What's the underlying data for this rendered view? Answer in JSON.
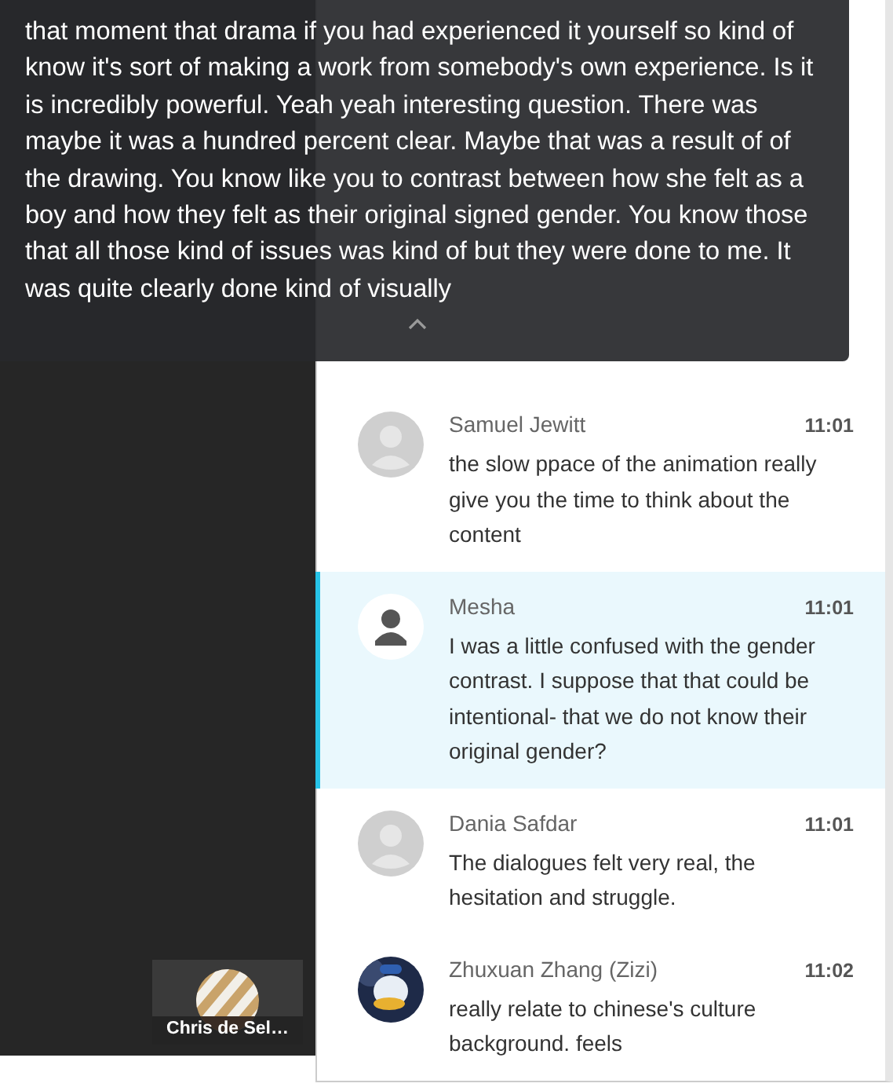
{
  "caption": {
    "text": "that moment that drama if you had experienced it yourself so kind of know it's sort of making a work from somebody's own experience. Is it is incredibly powerful. Yeah yeah interesting question. There was maybe it was a hundred percent clear. Maybe that was a result of of the drawing. You know like you to contrast between how she felt as a boy and how they felt as their original signed gender. You know those that all those kind of issues was kind of but they were done to me. It was quite clearly done kind of visually"
  },
  "participant_tile": {
    "name": "Chris de Sel…"
  },
  "messages": [
    {
      "name": "Samuel Jewitt",
      "time": "11:01",
      "text": "the slow ppace of the animation really give you the time to think about the content",
      "kind": "placeholder",
      "selected": false
    },
    {
      "name": "Mesha",
      "time": "11:01",
      "text": "I was a little confused with the gender contrast. I suppose that that could be intentional- that we do not know their original gender?",
      "kind": "silhouette",
      "selected": true
    },
    {
      "name": "Dania Safdar",
      "time": "11:01",
      "text": "The dialogues felt very real, the hesitation and struggle.",
      "kind": "placeholder",
      "selected": false
    },
    {
      "name": "Zhuxuan Zhang (Zizi)",
      "time": "11:02",
      "text": "really relate to chinese's culture background. feels",
      "kind": "picture",
      "selected": false
    }
  ]
}
